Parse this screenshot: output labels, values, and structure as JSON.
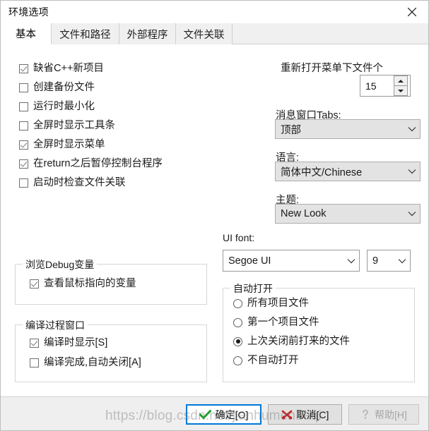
{
  "window": {
    "title": "环境选项",
    "close_icon": "close-icon"
  },
  "tabs": [
    {
      "label": "基本",
      "active": true
    },
    {
      "label": "文件和路径",
      "active": false
    },
    {
      "label": "外部程序",
      "active": false
    },
    {
      "label": "文件关联",
      "active": false
    }
  ],
  "general_checkboxes": [
    {
      "label": "缺省C++新项目",
      "checked": true
    },
    {
      "label": "创建备份文件",
      "checked": false
    },
    {
      "label": "运行时最小化",
      "checked": false
    },
    {
      "label": "全屏时显示工具条",
      "checked": false
    },
    {
      "label": "全屏时显示菜单",
      "checked": true
    },
    {
      "label": "在return之后暂停控制台程序",
      "checked": true
    },
    {
      "label": "启动时检查文件关联",
      "checked": false
    }
  ],
  "debug_group": {
    "title": "浏览Debug变量",
    "checkboxes": [
      {
        "label": "查看鼠标指向的变量",
        "checked": true
      }
    ]
  },
  "compile_group": {
    "title": "编译过程窗口",
    "checkboxes": [
      {
        "label": "编译时显示[S]",
        "checked": true
      },
      {
        "label": "编译完成,自动关闭[A]",
        "checked": false
      }
    ]
  },
  "recent_files": {
    "label": "重新打开菜单下文件个",
    "value": "15",
    "up_icon": "spinner-up-icon",
    "down_icon": "spinner-down-icon"
  },
  "message_tabs": {
    "label": "消息窗口Tabs:",
    "value": "顶部",
    "chevron_icon": "chevron-down-icon"
  },
  "language": {
    "label": "语言:",
    "value": "简体中文/Chinese",
    "chevron_icon": "chevron-down-icon"
  },
  "theme": {
    "label": "主题:",
    "value": "New Look",
    "chevron_icon": "chevron-down-icon"
  },
  "ui_font": {
    "label": "UI font:",
    "family_value": "Segoe UI",
    "size_value": "9",
    "chevron_icon": "chevron-down-icon"
  },
  "autoopen_group": {
    "title": "自动打开",
    "options": [
      {
        "label": "所有项目文件",
        "selected": false
      },
      {
        "label": "第一个项目文件",
        "selected": false
      },
      {
        "label": "上次关闭前打来的文件",
        "selected": true
      },
      {
        "label": "不自动打开",
        "selected": false
      }
    ]
  },
  "buttons": {
    "ok": {
      "label": "确定[O]",
      "icon": "check-icon"
    },
    "cancel": {
      "label": "取消[C]",
      "icon": "cancel-x-icon"
    },
    "help": {
      "label": "帮助[H]",
      "icon": "question-mark-icon",
      "disabled": true
    }
  },
  "watermark": {
    "text": "https://blog.csdn.net/jianhumenbaqi"
  },
  "colors": {
    "accent": "#0078d7",
    "ok_check": "#22a329",
    "cancel_x": "#cc1f1f",
    "dialog_bg": "#ffffff",
    "bottom_bar": "#efefef"
  }
}
